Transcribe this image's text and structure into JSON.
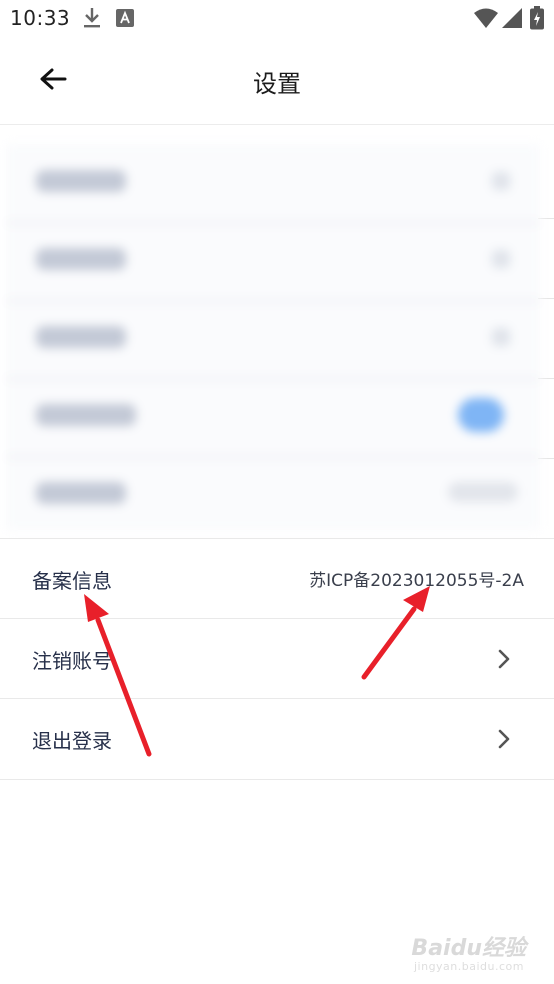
{
  "status_bar": {
    "time": "10:33",
    "icons": [
      "download-icon",
      "a-notification-icon",
      "wifi-icon",
      "signal-icon",
      "battery-charging-icon"
    ]
  },
  "header": {
    "title": "设置",
    "back_icon": "arrow-left-icon"
  },
  "settings": {
    "filing": {
      "label": "备案信息",
      "value": "苏ICP备2023012055号-2A"
    },
    "deactivate": {
      "label": "注销账号"
    },
    "logout": {
      "label": "退出登录"
    }
  },
  "watermark": {
    "text": "Baidu经验",
    "sub": "jingyan.baidu.com"
  },
  "colors": {
    "annotation_arrow": "#e8202a",
    "text": "#27304a"
  }
}
